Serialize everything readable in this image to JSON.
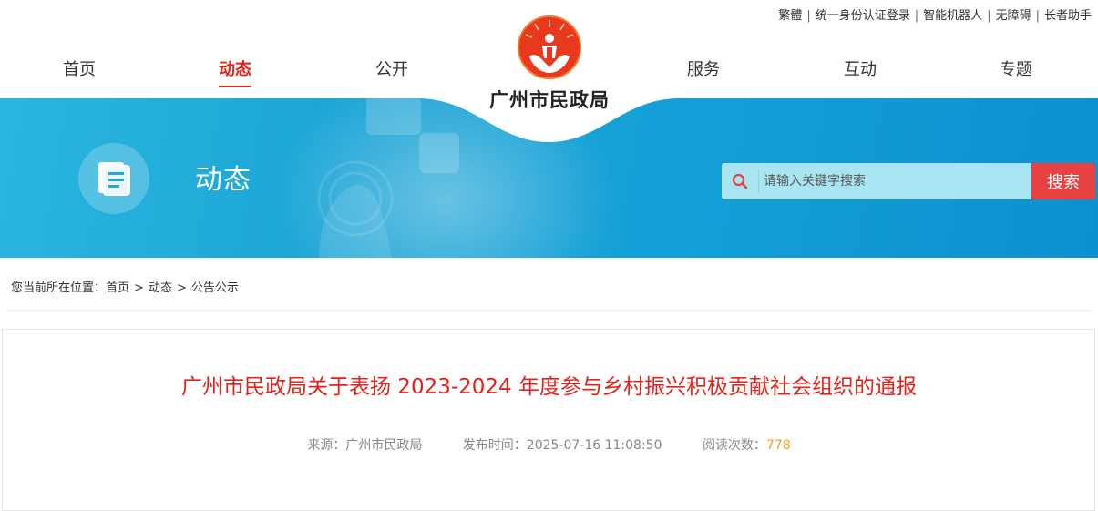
{
  "topbar": {
    "traditional": "繁體",
    "login": "统一身份认证登录",
    "robot": "智能机器人",
    "accessibility": "无障碍",
    "elder": "长者助手"
  },
  "nav": {
    "items": [
      {
        "label": "首页"
      },
      {
        "label": "动态"
      },
      {
        "label": "公开"
      },
      {
        "label": "服务"
      },
      {
        "label": "互动"
      },
      {
        "label": "专题"
      }
    ]
  },
  "logo": {
    "text": "广州市民政局"
  },
  "banner": {
    "title": "动态"
  },
  "search": {
    "placeholder": "请输入关键字搜索",
    "button": "搜索"
  },
  "breadcrumb": {
    "prefix": "您当前所在位置：",
    "items": [
      "首页",
      "动态",
      "公告公示"
    ],
    "separator": ">"
  },
  "article": {
    "title": "广州市民政局关于表扬 2023-2024 年度参与乡村振兴积极贡献社会组织的通报",
    "source_label": "来源：",
    "source": "广州市民政局",
    "time_label": "发布时间：",
    "time": "2025-07-16 11:08:50",
    "views_label": "阅读次数：",
    "views": "778"
  },
  "colors": {
    "accent_red": "#e2231a",
    "banner_blue": "#1aa3d5",
    "search_button": "#e84141",
    "view_count": "#f0a020"
  },
  "icons": {
    "logo": "guangzhou-civil-affairs-emblem",
    "banner": "document-icon",
    "search": "search-icon"
  }
}
